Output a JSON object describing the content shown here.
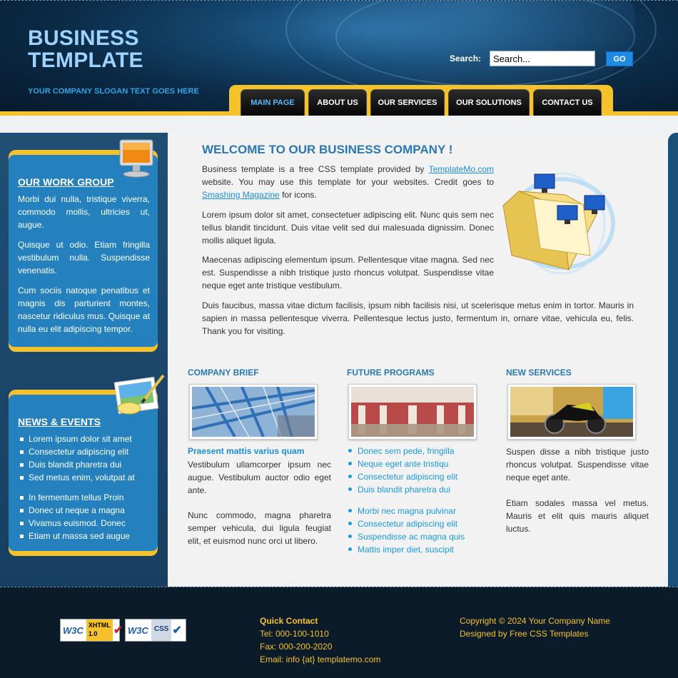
{
  "header": {
    "title_line1": "BUSINESS",
    "title_line2": "TEMPLATE",
    "slogan": "YOUR COMPANY SLOGAN TEXT GOES HERE",
    "search_label": "Search:",
    "search_value": "Search...",
    "go_label": "GO"
  },
  "nav": {
    "items": [
      {
        "label": "MAIN PAGE"
      },
      {
        "label": "ABOUT US"
      },
      {
        "label": "OUR SERVICES"
      },
      {
        "label": "OUR SOLUTIONS"
      },
      {
        "label": "CONTACT US"
      }
    ],
    "active_index": 0
  },
  "sidebar": {
    "work_group": {
      "title": "OUR WORK GROUP",
      "paragraphs": [
        "Morbi dui nulla, tristique viverra, commodo mollis, ultricies ut, augue.",
        "Quisque ut odio. Etiam fringilla vestibulum nulla. Suspendisse venenatis.",
        "Cum sociis natoque penatibus et magnis dis parturient montes, nascetur ridiculus mus. Quisque at nulla eu elit adipiscing tempor."
      ]
    },
    "news": {
      "title": "NEWS & EVENTS",
      "list1": [
        "Lorem ipsum dolor sit amet",
        "Consectetur adipiscing elit",
        "Duis blandit pharetra dui",
        "Sed metus enim, volutpat at"
      ],
      "list2": [
        "In fermentum tellus Proin",
        "Donec ut neque a magna",
        "Vivamus euismod. Donec",
        "Etiam ut massa sed augue"
      ]
    }
  },
  "main": {
    "welcome_title": "WELCOME TO OUR BUSINESS COMPANY !",
    "intro_pre": "Business template is a free CSS template provided by ",
    "intro_link1": "TemplateMo.com",
    "intro_mid": " website. You may use this template for your websites. Credit goes to ",
    "intro_link2": "Smashing Magazine",
    "intro_post": " for icons.",
    "para2": "Lorem ipsum dolor sit amet, consectetuer adipiscing elit. Nunc quis sem nec tellus blandit tincidunt. Duis vitae velit sed dui malesuada dignissim. Donec mollis aliquet ligula.",
    "para3": "Maecenas adipiscing elementum ipsum. Pellentesque vitae magna. Sed nec est. Suspendisse a nibh tristique justo rhoncus volutpat. Suspendisse vitae neque eget ante tristique vestibulum.",
    "para4": "Duis faucibus, massa vitae dictum facilisis, ipsum nibh facilisis nisi, ut scelerisque metus enim in tortor. Mauris in sapien in massa pellentesque viverra. Pellentesque lectus justo, fermentum in, ornare vitae, vehicula eu, felis. Thank you for visiting."
  },
  "columns": {
    "brief": {
      "title": "COMPANY BRIEF",
      "subtitle": "Praesent mattis varius quam",
      "text1": "Vestibulum ullamcorper ipsum nec augue. Vestibulum auctor odio eget ante.",
      "text2": "Nunc commodo, magna pharetra semper vehicula, dui ligula feugiat elit, et euismod nunc orci ut libero."
    },
    "future": {
      "title": "FUTURE PROGRAMS",
      "list1": [
        "Donec sem pede, fringilla",
        "Neque eget ante tristiqu",
        "Consectetur adipiscing elit",
        "Duis blandit pharetra dui"
      ],
      "list2": [
        "Morbi nec magna pulvinar",
        "Consectetur adipiscing elit",
        "Suspendisse ac magna quis",
        "Mattis imper diet, suscipit"
      ]
    },
    "services": {
      "title": "NEW SERVICES",
      "text1": "Suspen disse a nibh tristique justo rhoncus volutpat. Suspendisse vitae neque eget ante.",
      "text2": "Etiam sodales massa vel metus. Mauris et elit quis mauris aliquet luctus."
    }
  },
  "footer": {
    "badge_xhtml_w3c": "W3C",
    "badge_xhtml_label": "XHTML",
    "badge_xhtml_version": "1.0",
    "badge_css_w3c": "W3C",
    "badge_css_label": "CSS",
    "quick_contact_title": "Quick Contact",
    "tel": "Tel: 000-100-1010",
    "fax": "Fax: 000-200-2020",
    "email": "Email: info {at} templatemo.com",
    "copyright": "Copyright © 2024 Your Company Name",
    "designed_by": "Designed by Free CSS Templates"
  },
  "colors": {
    "accent_yellow": "#f6c22b",
    "sidebar_blue": "#2481bd",
    "heading_blue": "#2b78b0",
    "link_blue": "#1b9ad9"
  }
}
